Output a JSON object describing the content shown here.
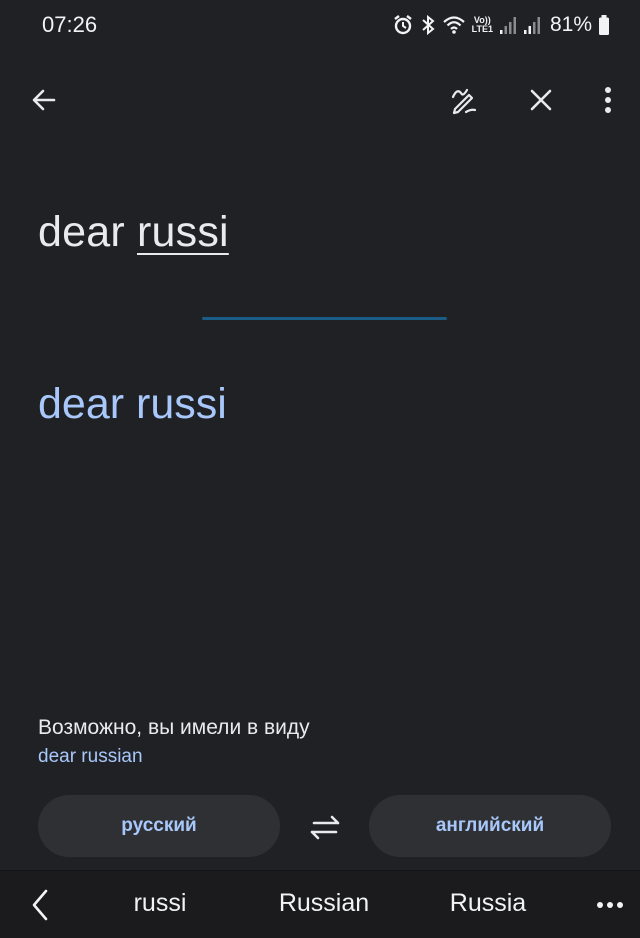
{
  "status_bar": {
    "time": "07:26",
    "lte_top": "Vo))",
    "lte_bottom": "LTE1",
    "battery": "81%",
    "icons": [
      "alarm-icon",
      "bluetooth-icon",
      "wifi-icon",
      "signal-icon",
      "signal-icon",
      "battery-icon"
    ]
  },
  "toolbar": {
    "icons": [
      "back-arrow-icon",
      "handwriting-icon",
      "close-icon",
      "more-vert-icon"
    ]
  },
  "source": {
    "plain": "dear ",
    "underlined": "russi"
  },
  "translation": {
    "text": "dear russi"
  },
  "suggestion": {
    "label": "Возможно, вы имели в виду",
    "link": "dear russian"
  },
  "languages": {
    "source": "русский",
    "target": "английский",
    "swap_icon": "swap-icon"
  },
  "keyboard": {
    "suggestions": [
      "russi",
      "Russian",
      "Russia"
    ],
    "icons": [
      "chevron-left-icon",
      "more-horiz-icon"
    ]
  },
  "colors": {
    "background": "#202124",
    "text": "#e8eaed",
    "accent": "#a8c7fa",
    "chip": "#2f3033",
    "divider": "#1a5c86",
    "keyboard": "#1b1b1d"
  }
}
